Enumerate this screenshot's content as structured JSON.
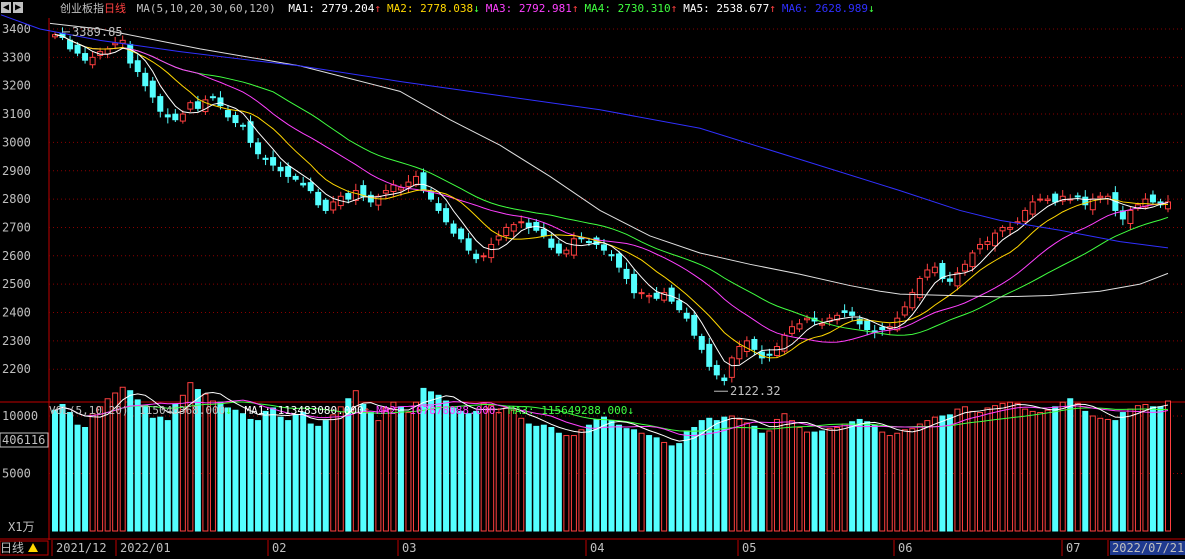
{
  "toolbar": {
    "left_arrow": "◀",
    "right_arrow": "▶"
  },
  "header": {
    "index_name": "创业板指",
    "period": "日线",
    "ma_spec": "MA(5,10,20,30,60,120)",
    "ma": [
      {
        "label": "MA1:",
        "value": "2779.204",
        "arrow": "↑",
        "color": "#ffffff"
      },
      {
        "label": "MA2:",
        "value": "2778.038",
        "arrow": "↓",
        "color": "#ffd700"
      },
      {
        "label": "MA3:",
        "value": "2792.981",
        "arrow": "↑",
        "color": "#ff40ff"
      },
      {
        "label": "MA4:",
        "value": "2730.310",
        "arrow": "↑",
        "color": "#40ff40"
      },
      {
        "label": "MA5:",
        "value": "2538.677",
        "arrow": "↑",
        "color": "#ffffff"
      },
      {
        "label": "MA6:",
        "value": "2628.989",
        "arrow": "↓",
        "color": "#3030ff"
      }
    ]
  },
  "vol_header": {
    "spec": "VOL(5,10,20)",
    "value": "115046368.000",
    "value_arrow": "↓",
    "ma": [
      {
        "label": "MA1:",
        "value": "113483080.000",
        "arrow": "↑",
        "color": "#ffffff"
      },
      {
        "label": "MA2:",
        "value": "107878088.000",
        "arrow": "↑",
        "color": "#ff40ff"
      },
      {
        "label": "MA3:",
        "value": "115649288.000",
        "arrow": "↓",
        "color": "#40ff40"
      }
    ]
  },
  "price_axis_labels": [
    "3400",
    "3300",
    "3200",
    "3100",
    "3000",
    "2900",
    "2800",
    "2700",
    "2600",
    "2500",
    "2400",
    "2300",
    "2200"
  ],
  "vol_axis_labels": [
    "10000",
    "5000"
  ],
  "vol_unit": "X1万",
  "vol_current_tag": "406116",
  "annotations": {
    "high": "3389.85",
    "low": "2122.32"
  },
  "date_labels": [
    "2021/12",
    "2022/01",
    "02",
    "03",
    "04",
    "05",
    "06",
    "07",
    "2022/07/21"
  ],
  "period_tab": "日线",
  "colors": {
    "up": "#ff4040",
    "down": "#54ffff",
    "grid": "#8b0000",
    "axis": "#c00000"
  },
  "chart_data": {
    "type": "candlestick",
    "price_range": [
      2122.32,
      3389.85
    ],
    "ma_lines": [
      {
        "name": "MA1",
        "period": 5,
        "color": "#ffffff",
        "last": 2779.204
      },
      {
        "name": "MA2",
        "period": 10,
        "color": "#ffd700",
        "last": 2778.038
      },
      {
        "name": "MA3",
        "period": 20,
        "color": "#ff40ff",
        "last": 2792.981
      },
      {
        "name": "MA4",
        "period": 30,
        "color": "#40ff40",
        "last": 2730.31
      },
      {
        "name": "MA5",
        "period": 60,
        "color": "#ffffff",
        "last": 2538.677
      },
      {
        "name": "MA6",
        "period": 120,
        "color": "#3030ff",
        "last": 2628.989
      }
    ],
    "ma6_path": [
      [
        1,
        3450
      ],
      [
        40,
        3400
      ],
      [
        100,
        3360
      ],
      [
        180,
        3320
      ],
      [
        250,
        3290
      ],
      [
        300,
        3270
      ],
      [
        400,
        3215
      ],
      [
        500,
        3165
      ],
      [
        600,
        3115
      ],
      [
        700,
        3050
      ],
      [
        800,
        2940
      ],
      [
        900,
        2830
      ],
      [
        960,
        2760
      ],
      [
        1000,
        2725
      ],
      [
        1060,
        2690
      ],
      [
        1120,
        2650
      ],
      [
        1168,
        2628
      ]
    ],
    "ma5_path": [
      [
        50,
        3420
      ],
      [
        100,
        3400
      ],
      [
        200,
        3330
      ],
      [
        300,
        3270
      ],
      [
        400,
        3180
      ],
      [
        450,
        3080
      ],
      [
        500,
        2990
      ],
      [
        550,
        2880
      ],
      [
        600,
        2760
      ],
      [
        650,
        2670
      ],
      [
        700,
        2610
      ],
      [
        750,
        2570
      ],
      [
        800,
        2535
      ],
      [
        850,
        2495
      ],
      [
        880,
        2475
      ],
      [
        900,
        2465
      ],
      [
        950,
        2460
      ],
      [
        1000,
        2455
      ],
      [
        1050,
        2460
      ],
      [
        1100,
        2475
      ],
      [
        1140,
        2500
      ],
      [
        1168,
        2538
      ]
    ],
    "closes": [
      3380,
      3370,
      3330,
      3315,
      3290,
      3300,
      3320,
      3330,
      3350,
      3360,
      3280,
      3250,
      3200,
      3160,
      3110,
      3090,
      3080,
      3100,
      3140,
      3120,
      3150,
      3160,
      3130,
      3090,
      3070,
      3060,
      3000,
      2960,
      2940,
      2920,
      2900,
      2880,
      2870,
      2850,
      2830,
      2780,
      2760,
      2790,
      2810,
      2800,
      2830,
      2810,
      2790,
      2810,
      2830,
      2850,
      2840,
      2860,
      2880,
      2830,
      2800,
      2760,
      2720,
      2680,
      2660,
      2620,
      2590,
      2600,
      2640,
      2670,
      2700,
      2710,
      2720,
      2700,
      2690,
      2670,
      2630,
      2610,
      2620,
      2660,
      2660,
      2650,
      2640,
      2620,
      2600,
      2560,
      2520,
      2470,
      2470,
      2460,
      2450,
      2470,
      2440,
      2410,
      2380,
      2320,
      2270,
      2210,
      2180,
      2160,
      2240,
      2280,
      2300,
      2270,
      2240,
      2250,
      2280,
      2320,
      2350,
      2360,
      2380,
      2370,
      2360,
      2380,
      2390,
      2400,
      2390,
      2360,
      2340,
      2330,
      2340,
      2350,
      2380,
      2420,
      2470,
      2520,
      2550,
      2560,
      2520,
      2510,
      2540,
      2570,
      2610,
      2640,
      2650,
      2680,
      2700,
      2700,
      2720,
      2760,
      2790,
      2800,
      2800,
      2790,
      2810,
      2800,
      2810,
      2780,
      2800,
      2810,
      2810,
      2760,
      2730,
      2760,
      2780,
      2800,
      2790,
      2780,
      2790
    ],
    "volumes": [
      10500,
      11000,
      10300,
      9200,
      9000,
      10200,
      10800,
      11500,
      12000,
      12500,
      12200,
      11400,
      10900,
      9800,
      9900,
      9600,
      11000,
      11800,
      12900,
      12300,
      11900,
      11300,
      11200,
      10700,
      10500,
      10200,
      9700,
      9600,
      10400,
      10700,
      9900,
      9600,
      10100,
      10300,
      9300,
      9100,
      9600,
      10100,
      10800,
      11500,
      12200,
      11000,
      10300,
      9600,
      10700,
      11200,
      10800,
      10300,
      11200,
      12400,
      12100,
      11800,
      11300,
      10700,
      10400,
      10200,
      10400,
      11100,
      10900,
      10300,
      10700,
      10500,
      9800,
      9300,
      9100,
      9200,
      9000,
      8500,
      8300,
      8300,
      8800,
      9200,
      9700,
      9900,
      9600,
      9200,
      8900,
      8800,
      8500,
      8300,
      8100,
      7700,
      7400,
      7600,
      8700,
      9000,
      9600,
      9800,
      9600,
      9900,
      10000,
      9700,
      9400,
      9100,
      8500,
      8700,
      9700,
      10200,
      9600,
      9000,
      8600,
      8600,
      8700,
      8900,
      9000,
      9300,
      9500,
      9700,
      9500,
      9200,
      8600,
      8300,
      8500,
      8800,
      8900,
      9300,
      9600,
      9900,
      10000,
      10100,
      10600,
      10800,
      10400,
      10300,
      10700,
      10900,
      11100,
      11200,
      11100,
      10600,
      10400,
      10300,
      10500,
      10800,
      11200,
      11500,
      11100,
      10400,
      10000,
      9800,
      9700,
      9600,
      10300,
      10600,
      10900,
      11000,
      10800,
      10800,
      11300
    ]
  }
}
